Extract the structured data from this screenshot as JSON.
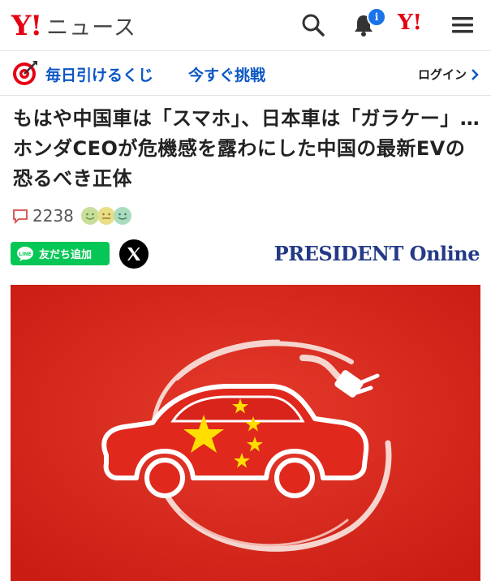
{
  "header": {
    "logo_y": "Y!",
    "logo_news": "ニュース",
    "small_logo": "Y!",
    "notification_badge": "i",
    "icons": [
      "search-icon",
      "bell-icon",
      "menu-icon"
    ]
  },
  "lottery": {
    "label": "毎日引けるくじ",
    "cta": "今すぐ挑戦",
    "login": "ログイン"
  },
  "article": {
    "title": "もはや中国車は「スマホ」、日本車は「ガラケー」…ホンダCEOが危機感を露わにした中国の最新EVの恐るべき正体",
    "comment_count": "2238",
    "line_button": "友だち追加",
    "publisher": "PRESIDENT Online"
  },
  "colors": {
    "brand_red": "#e60013",
    "link_blue": "#0b56c4",
    "line_green": "#06c755",
    "publisher_navy": "#243a86",
    "hero_red": "#d8241a"
  }
}
